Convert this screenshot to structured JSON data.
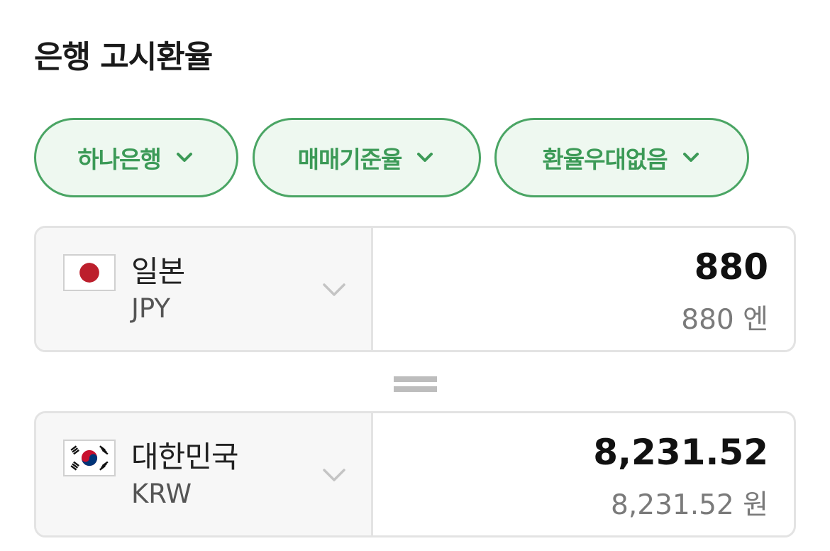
{
  "header": {
    "title": "은행 고시환율"
  },
  "filters": [
    {
      "label": "하나은행",
      "icon": "chevron-down-icon"
    },
    {
      "label": "매매기준율",
      "icon": "chevron-down-icon"
    },
    {
      "label": "환율우대없음",
      "icon": "chevron-down-icon"
    }
  ],
  "from": {
    "country": "일본",
    "code": "JPY",
    "flag": "japan-flag-icon",
    "amount": "880",
    "amount_text": "880 엔"
  },
  "to": {
    "country": "대한민국",
    "code": "KRW",
    "flag": "korea-flag-icon",
    "amount": "8,231.52",
    "amount_text": "8,231.52 원"
  },
  "colors": {
    "accent": "#3c9a57",
    "chip_bg": "#eef8f0",
    "japan_red": "#bc1f2c",
    "korea_red": "#c8102e",
    "korea_blue": "#003478"
  }
}
